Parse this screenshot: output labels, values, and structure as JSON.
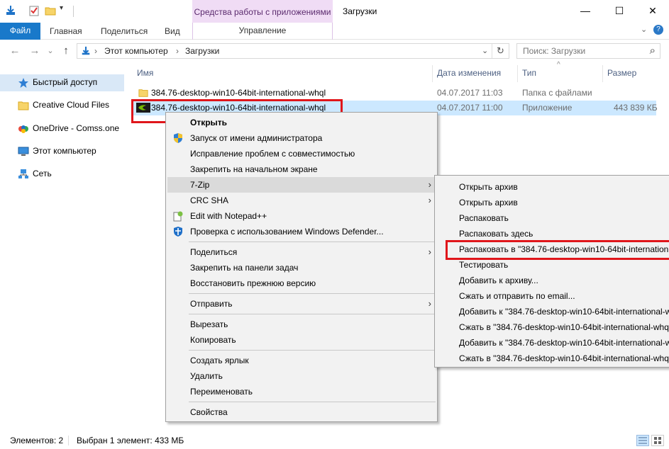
{
  "window": {
    "title": "Загрузки",
    "context_tab_header": "Средства работы с приложениями",
    "minimize": "—",
    "maximize": "☐",
    "close": "✕"
  },
  "ribbon": {
    "file": "Файл",
    "home": "Главная",
    "share": "Поделиться",
    "view": "Вид",
    "manage": "Управление",
    "collapse": "⌄",
    "help": "?"
  },
  "address": {
    "back": "←",
    "forward": "→",
    "recent": "⌄",
    "up": "↑",
    "sep1": "›",
    "crumb1": "Этот компьютер",
    "sep2": "›",
    "crumb2": "Загрузки",
    "dropdown": "⌄",
    "refresh": "↻",
    "search_placeholder": "Поиск: Загрузки",
    "search_icon": "⌕"
  },
  "nav": {
    "items": [
      {
        "label": "Быстрый доступ",
        "icon": "star-icon"
      },
      {
        "label": "Creative Cloud Files",
        "icon": "folder-icon"
      },
      {
        "label": "OneDrive - Comss.one",
        "icon": "cloud-icon"
      },
      {
        "label": "Этот компьютер",
        "icon": "computer-icon"
      },
      {
        "label": "Сеть",
        "icon": "network-icon"
      }
    ]
  },
  "columns": {
    "name": "Имя",
    "date": "Дата изменения",
    "type": "Тип",
    "size": "Размер",
    "sort_arrow": "^"
  },
  "files": [
    {
      "name": "384.76-desktop-win10-64bit-international-whql",
      "date": "04.07.2017 11:03",
      "type": "Папка с файлами",
      "size": ""
    },
    {
      "name": "384.76-desktop-win10-64bit-international-whql",
      "date": "04.07.2017 11:00",
      "type": "Приложение",
      "size": "443 839 КБ"
    }
  ],
  "context_menu": {
    "items": [
      "Открыть",
      "Запуск от имени администратора",
      "Исправление проблем с совместимостью",
      "Закрепить на начальном экране",
      "7-Zip",
      "CRC SHA",
      "Edit with Notepad++",
      "Проверка с использованием Windows Defender...",
      "Поделиться",
      "Закрепить на панели задач",
      "Восстановить прежнюю версию",
      "Отправить",
      "Вырезать",
      "Копировать",
      "Создать ярлык",
      "Удалить",
      "Переименовать",
      "Свойства"
    ],
    "arrow": "›"
  },
  "submenu": {
    "items": [
      "Открыть архив",
      "Открыть архив",
      "Распаковать",
      "Распаковать здесь",
      "Распаковать в \"384.76-desktop-win10-64bit-internation",
      "Тестировать",
      "Добавить к архиву...",
      "Сжать и отправить по email...",
      "Добавить к \"384.76-desktop-win10-64bit-international-w",
      "Сжать в \"384.76-desktop-win10-64bit-international-whq",
      "Добавить к \"384.76-desktop-win10-64bit-international-w",
      "Сжать в \"384.76-desktop-win10-64bit-international-whq"
    ]
  },
  "status": {
    "count": "Элементов: 2",
    "selected": "Выбран 1 элемент: 433 МБ"
  },
  "colors": {
    "accent": "#1979ca",
    "context_tab": "#f0dcf5",
    "selection": "#cce8ff",
    "highlight_box": "#e0161b"
  }
}
